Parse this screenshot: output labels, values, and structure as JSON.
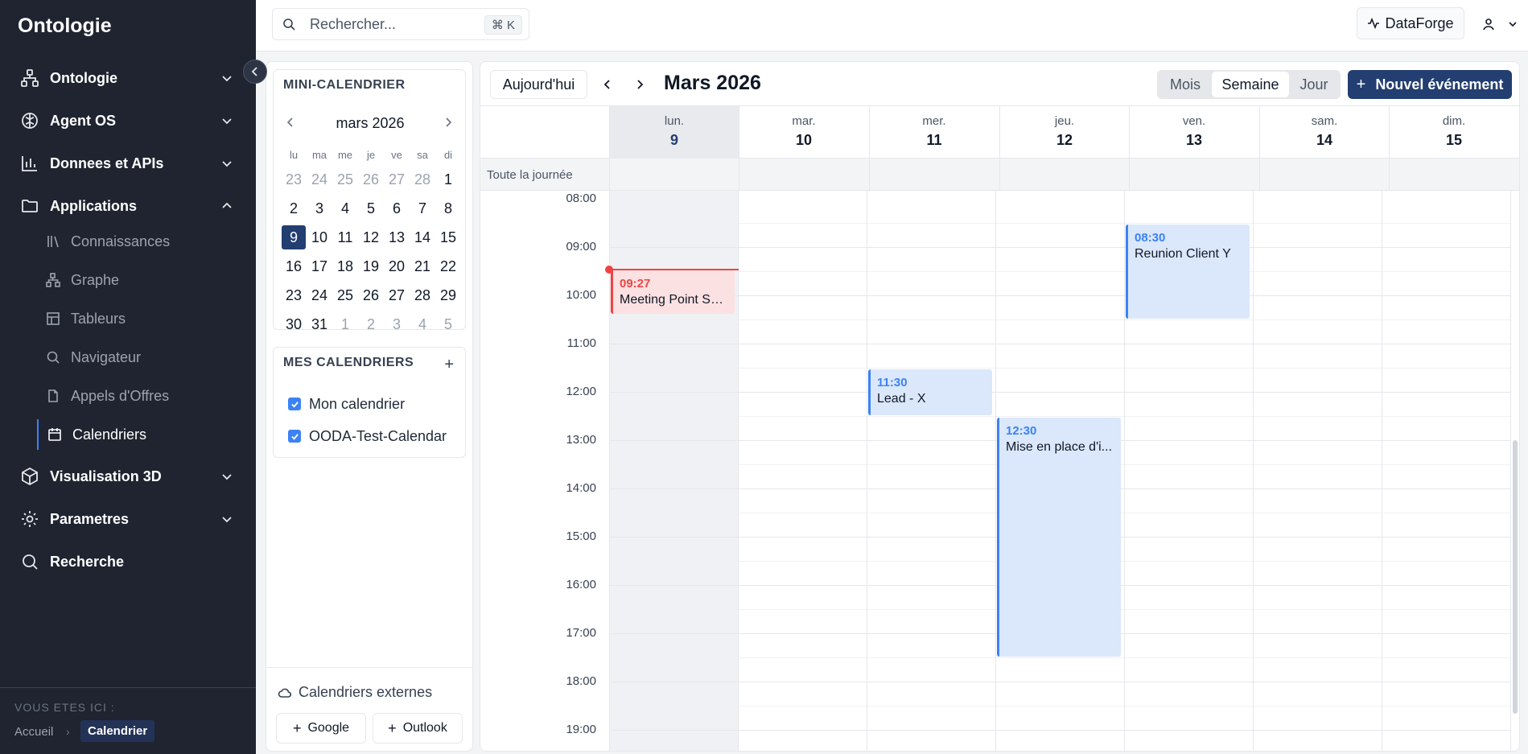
{
  "app": {
    "brand": "Ontologie"
  },
  "sidebar": {
    "items": [
      {
        "label": "Ontologie",
        "icon": "network-icon"
      },
      {
        "label": "Agent OS",
        "icon": "brain-icon"
      },
      {
        "label": "Donnees et APIs",
        "icon": "bar-chart-icon"
      },
      {
        "label": "Applications",
        "icon": "folder-icon"
      },
      {
        "label": "Visualisation 3D",
        "icon": "cube-icon"
      },
      {
        "label": "Parametres",
        "icon": "gear-icon"
      },
      {
        "label": "Recherche",
        "icon": "search-icon"
      }
    ],
    "subitems": [
      {
        "label": "Connaissances",
        "icon": "library-icon"
      },
      {
        "label": "Graphe",
        "icon": "graph-icon"
      },
      {
        "label": "Tableurs",
        "icon": "table-icon"
      },
      {
        "label": "Navigateur",
        "icon": "search-icon"
      },
      {
        "label": "Appels d'Offres",
        "icon": "document-icon"
      },
      {
        "label": "Calendriers",
        "icon": "calendar-icon"
      }
    ],
    "breadcrumb": {
      "label": "VOUS ETES ICI :",
      "home": "Accueil",
      "current": "Calendrier"
    }
  },
  "topbar": {
    "search_placeholder": "Rechercher...",
    "shortcut": "⌘ K",
    "workspace": "DataForge"
  },
  "minicalendar": {
    "title": "MINI-CALENDRIER",
    "month": "mars 2026",
    "dow": [
      "lu",
      "ma",
      "me",
      "je",
      "ve",
      "sa",
      "di"
    ],
    "weeks": [
      [
        "23",
        "24",
        "25",
        "26",
        "27",
        "28",
        "1"
      ],
      [
        "2",
        "3",
        "4",
        "5",
        "6",
        "7",
        "8"
      ],
      [
        "9",
        "10",
        "11",
        "12",
        "13",
        "14",
        "15"
      ],
      [
        "16",
        "17",
        "18",
        "19",
        "20",
        "21",
        "22"
      ],
      [
        "23",
        "24",
        "25",
        "26",
        "27",
        "28",
        "29"
      ],
      [
        "30",
        "31",
        "1",
        "2",
        "3",
        "4",
        "5"
      ]
    ],
    "today": "9"
  },
  "calendars": {
    "title": "MES CALENDRIERS",
    "add": "+",
    "items": [
      {
        "label": "Mon calendrier",
        "checked": true
      },
      {
        "label": "OODA-Test-Calendar",
        "checked": true
      }
    ],
    "external_title": "Calendriers externes",
    "google": "Google",
    "outlook": "Outlook"
  },
  "main": {
    "today_label": "Aujourd'hui",
    "title": "Mars 2026",
    "views": [
      "Mois",
      "Semaine",
      "Jour"
    ],
    "active_view": "Semaine",
    "new_event": "Nouvel événement",
    "allday_label": "Toute la journée",
    "days": [
      {
        "name": "lun.",
        "num": "9",
        "today": true
      },
      {
        "name": "mar.",
        "num": "10"
      },
      {
        "name": "mer.",
        "num": "11"
      },
      {
        "name": "jeu.",
        "num": "12"
      },
      {
        "name": "ven.",
        "num": "13"
      },
      {
        "name": "sam.",
        "num": "14"
      },
      {
        "name": "dim.",
        "num": "15"
      }
    ],
    "hours": [
      "08:00",
      "09:00",
      "10:00",
      "11:00",
      "12:00",
      "13:00",
      "14:00",
      "15:00",
      "16:00",
      "17:00",
      "18:00",
      "19:00"
    ],
    "now_time": "09:27",
    "events": [
      {
        "day": 0,
        "time": "09:27",
        "title": "Meeting Point Se...",
        "start": 9.45,
        "end": 10.4,
        "style": "red"
      },
      {
        "day": 4,
        "time": "08:30",
        "title": "Reunion Client Y",
        "start": 8.5,
        "end": 10.5,
        "style": "blue"
      },
      {
        "day": 2,
        "time": "11:30",
        "title": "Lead - X",
        "start": 11.5,
        "end": 12.5,
        "style": "blue"
      },
      {
        "day": 3,
        "time": "12:30",
        "title": "Mise en place d'i...",
        "start": 12.5,
        "end": 17.5,
        "style": "blue"
      }
    ]
  },
  "colors": {
    "accent": "#233e70",
    "event_blue": "#3b82f6",
    "now_red": "#ef4444",
    "sidebar_bg": "#1f2430"
  }
}
